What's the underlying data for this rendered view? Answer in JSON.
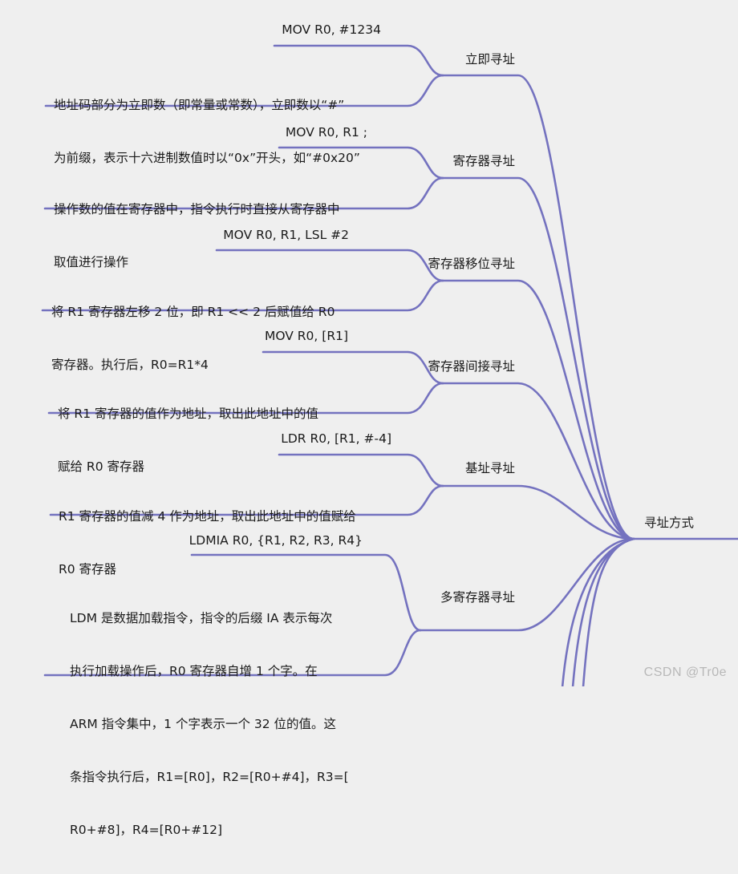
{
  "root": {
    "label": "寻址方式"
  },
  "branches": [
    {
      "label": "立即寻址",
      "example": "MOV R0, #1234",
      "description": [
        "地址码部分为立即数（即常量或常数），立即数以“#”",
        "为前缀，表示十六进制数值时以“0x”开头，如“#0x20”"
      ]
    },
    {
      "label": "寄存器寻址",
      "example": "MOV R0, R1 ;",
      "description": [
        "操作数的值在寄存器中，指令执行时直接从寄存器中",
        "取值进行操作"
      ]
    },
    {
      "label": "寄存器移位寻址",
      "example": "MOV R0, R1, LSL #2",
      "description": [
        "将 R1 寄存器左移 2 位，即 R1 << 2 后赋值给 R0",
        "寄存器。执行后，R0=R1*4"
      ]
    },
    {
      "label": "寄存器间接寻址",
      "example": "MOV R0, [R1]",
      "description": [
        "将 R1 寄存器的值作为地址，取出此地址中的值",
        "赋给 R0 寄存器"
      ]
    },
    {
      "label": "基址寻址",
      "example": "LDR R0, [R1, #-4]",
      "description": [
        "R1 寄存器的值减 4 作为地址，取出此地址中的值赋给",
        "R0 寄存器"
      ]
    },
    {
      "label": "多寄存器寻址",
      "example": "LDMIA R0, {R1, R2, R3, R4}",
      "description": [
        "LDM 是数据加载指令，指令的后缀 IA 表示每次",
        "执行加载操作后，R0 寄存器自增 1 个字。在",
        "ARM 指令集中，1 个字表示一个 32 位的值。这",
        "条指令执行后，R1=[R0]，R2=[R0+#4]，R3=[",
        "R0+#8]，R4=[R0+#12]"
      ]
    }
  ],
  "offscreen_branch_count": 3,
  "watermark": "CSDN @Tr0e",
  "colors": {
    "line": "#7472bf",
    "background": "#efefef",
    "text": "#1a1a1a"
  }
}
